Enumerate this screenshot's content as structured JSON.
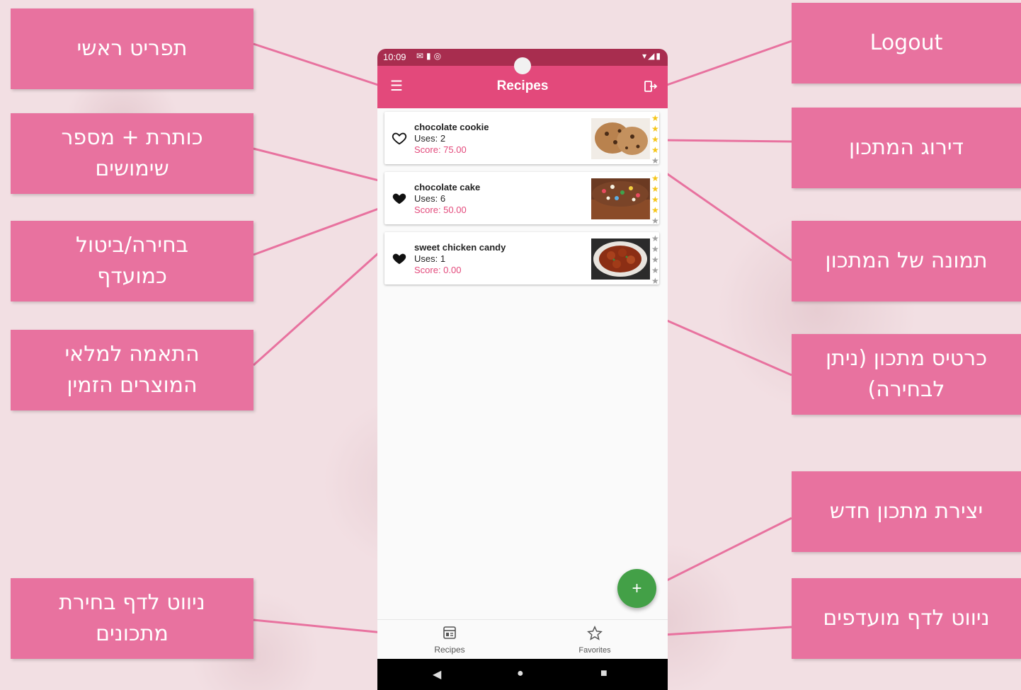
{
  "annotations": {
    "main_menu": "תפריט ראשי",
    "title_uses": [
      "כותרת + מספר",
      "שימושים"
    ],
    "favorite_toggle": [
      "בחירה/ביטול",
      "כמועדף"
    ],
    "pantry_match": [
      "התאמה למלאי",
      "המוצרים הזמין"
    ],
    "nav_recipes": [
      "ניווט לדף בחירת",
      "מתכונים"
    ],
    "logout": "Logout",
    "rating": "דירוג המתכון",
    "recipe_image": "תמונה של המתכון",
    "recipe_card": [
      "כרטיס מתכון (ניתן",
      "לבחירה)"
    ],
    "new_recipe": "יצירת מתכון חדש",
    "nav_favorites": "ניווט לדף מועדפים"
  },
  "status_bar": {
    "time": "10:09"
  },
  "app_bar": {
    "title": "Recipes",
    "menu_icon": "menu-icon",
    "logout_icon": "logout-icon"
  },
  "recipes": [
    {
      "name": "chocolate cookie",
      "uses": "Uses: 2",
      "score": "Score: 75.00",
      "favorite": false,
      "rating": 4
    },
    {
      "name": "chocolate cake",
      "uses": "Uses: 6",
      "score": "Score: 50.00",
      "favorite": true,
      "rating": 4
    },
    {
      "name": "sweet chicken candy",
      "uses": "Uses: 1",
      "score": "Score: 0.00",
      "favorite": true,
      "rating": 0
    }
  ],
  "fab": {
    "icon": "plus-icon",
    "glyph": "+"
  },
  "bottom_nav": {
    "recipes_label": "Recipes",
    "favorites_label": "Favorites"
  },
  "colors": {
    "callout": "#e8729f",
    "app_bar": "#e3497b",
    "status_bar": "#a82d4f",
    "score_text": "#e3497b",
    "fab": "#43a047",
    "star_on": "#f5c518",
    "star_off": "#9e9e9e"
  }
}
